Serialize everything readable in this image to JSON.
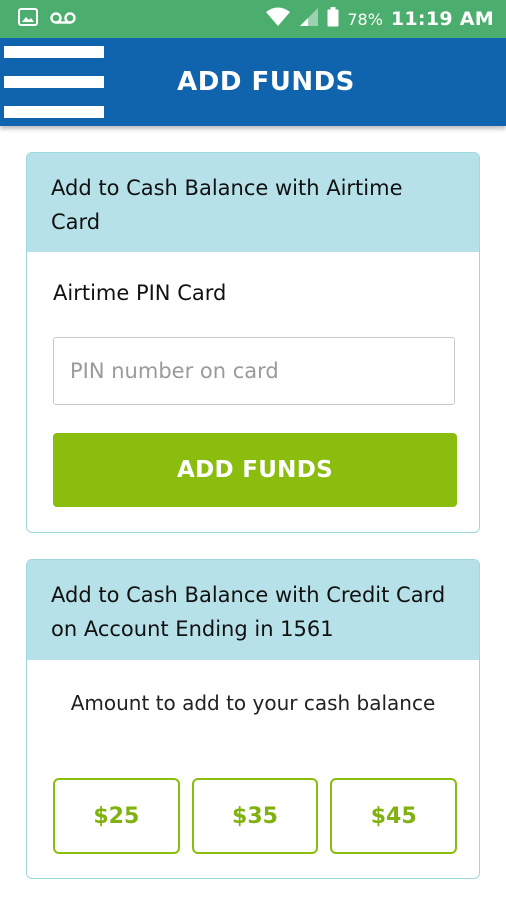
{
  "status_bar": {
    "battery": "78%",
    "time": "11:19 AM",
    "icons": [
      "gallery-icon",
      "voicemail-icon",
      "wifi-icon",
      "cell-signal-icon",
      "battery-icon"
    ]
  },
  "app_bar": {
    "title": "ADD FUNDS",
    "menu_icon": "hamburger-menu-icon"
  },
  "airtime_card": {
    "header": "Add to Cash Balance with Airtime Card",
    "field_label": "Airtime PIN Card",
    "pin_value": "",
    "pin_placeholder": "PIN number on card",
    "submit_label": "ADD FUNDS"
  },
  "credit_card": {
    "header": "Add to Cash Balance with Credit Card on Account Ending in 1561",
    "amount_label": "Amount to add to your cash balance",
    "amounts": [
      "$25",
      "$35",
      "$45"
    ]
  },
  "colors": {
    "status_bar": "#4cae6e",
    "app_bar": "#0f64ad",
    "card_header": "#b7e1e8",
    "accent_green": "#8bbd0f"
  }
}
